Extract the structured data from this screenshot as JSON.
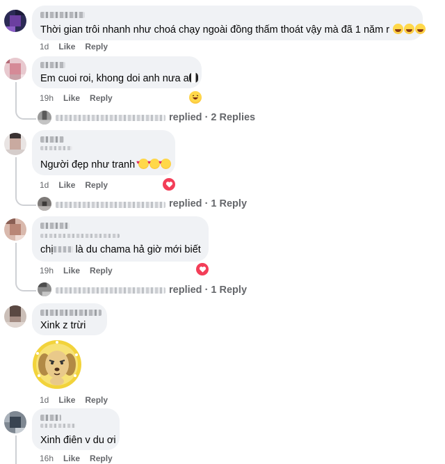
{
  "comments": [
    {
      "text": "Thời gian trôi nhanh như choá chạy ngoài đồng thấm thoát vậy mà đã 1 năm r",
      "emoji_count": 3,
      "time": "1d",
      "like": "Like",
      "reply": "Reply"
    },
    {
      "text": "Em cuoi roi, khong doi anh nưa a",
      "time": "19h",
      "like": "Like",
      "reply": "Reply",
      "reaction_icon": "laugh-reaction-icon",
      "replies_summary": "replied · 2 Replies"
    },
    {
      "text": "Người đẹp như tranh",
      "time": "1d",
      "like": "Like",
      "reply": "Reply",
      "reaction_icon": "love-reaction-icon",
      "replies_summary": "replied · 1 Reply"
    },
    {
      "text_before": "chị",
      "text_after": "là du chama hả giờ mới biết",
      "time": "19h",
      "like": "Like",
      "reply": "Reply",
      "reaction_icon": "love-reaction-icon",
      "replies_summary": "replied · 1 Reply"
    },
    {
      "text": "Xink z trừi",
      "time": "1d",
      "like": "Like",
      "reply": "Reply",
      "sticker": "dog-sticker"
    },
    {
      "text": "Xinh điên v du ơi",
      "time": "16h",
      "like": "Like",
      "reply": "Reply"
    }
  ],
  "colors": {
    "bubble": "#f0f2f5",
    "meta": "#65676b",
    "love": "#f33e58",
    "thread": "#ced0d4"
  }
}
